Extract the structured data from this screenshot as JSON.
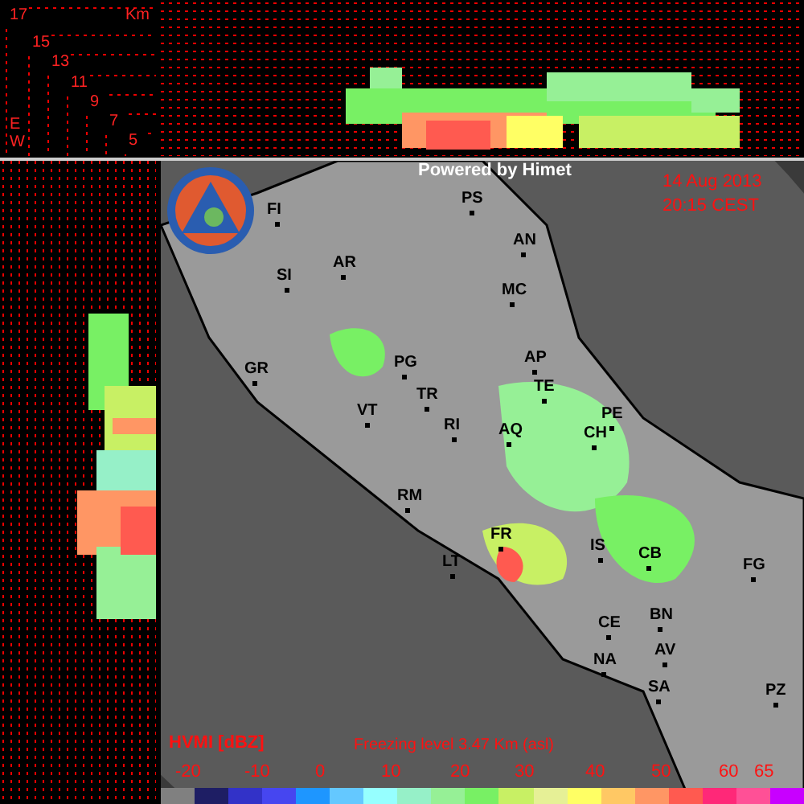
{
  "height_scale": {
    "unit": "Km",
    "labels": [
      "17",
      "15",
      "13",
      "11",
      "9",
      "7",
      "5"
    ],
    "axis_letters": [
      "E",
      "W"
    ]
  },
  "map": {
    "credit": "Powered by Himet",
    "date": "14 Aug 2013",
    "time": "20:15 CEST",
    "cities": [
      {
        "name": "FI"
      },
      {
        "name": "SI"
      },
      {
        "name": "AR"
      },
      {
        "name": "PS"
      },
      {
        "name": "AN"
      },
      {
        "name": "MC"
      },
      {
        "name": "PG"
      },
      {
        "name": "AP"
      },
      {
        "name": "TE"
      },
      {
        "name": "GR"
      },
      {
        "name": "VT"
      },
      {
        "name": "TR"
      },
      {
        "name": "RI"
      },
      {
        "name": "AQ"
      },
      {
        "name": "PE"
      },
      {
        "name": "CH"
      },
      {
        "name": "RM"
      },
      {
        "name": "FR"
      },
      {
        "name": "IS"
      },
      {
        "name": "CB"
      },
      {
        "name": "FG"
      },
      {
        "name": "LT"
      },
      {
        "name": "CE"
      },
      {
        "name": "BN"
      },
      {
        "name": "NA"
      },
      {
        "name": "AV"
      },
      {
        "name": "SA"
      },
      {
        "name": "PZ"
      }
    ]
  },
  "legend": {
    "title": "HVMI [dBZ]",
    "freezing_level": "Freezing level  3.47 Km (asl)",
    "labels": [
      "-20",
      "-10",
      "0",
      "10",
      "20",
      "30",
      "40",
      "50",
      "60",
      "65"
    ],
    "swatches": [
      {
        "color": "#808080"
      },
      {
        "color": "#1e1e64"
      },
      {
        "color": "#3232c8"
      },
      {
        "color": "#4646f0"
      },
      {
        "color": "#1e96ff"
      },
      {
        "color": "#64c8ff"
      },
      {
        "color": "#96ffff"
      },
      {
        "color": "#96f0c8"
      },
      {
        "color": "#96f096"
      },
      {
        "color": "#78f064"
      },
      {
        "color": "#c8f064"
      },
      {
        "color": "#e6f096"
      },
      {
        "color": "#ffff64"
      },
      {
        "color": "#ffc864"
      },
      {
        "color": "#ff9664"
      },
      {
        "color": "#ff5a50"
      },
      {
        "color": "#ff2878"
      },
      {
        "color": "#ff5096"
      },
      {
        "color": "#c800ff"
      }
    ]
  }
}
